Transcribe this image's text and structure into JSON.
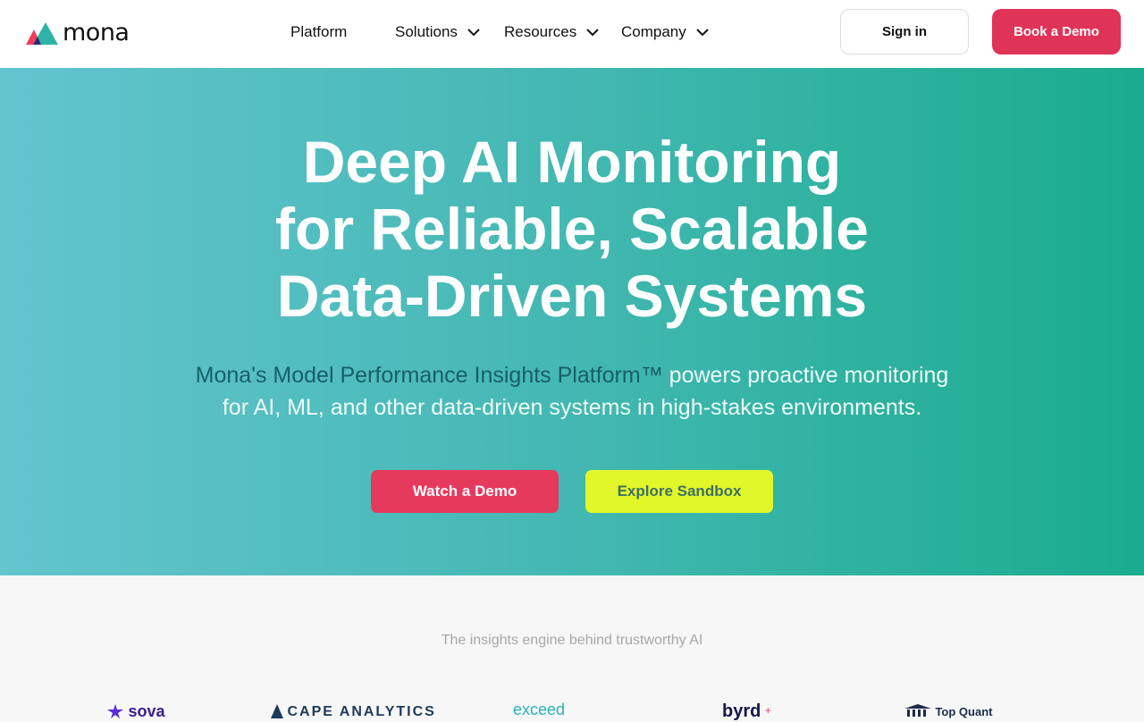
{
  "header": {
    "logo_text": "mona",
    "nav": [
      {
        "label": "Platform",
        "has_dropdown": false
      },
      {
        "label": "Solutions",
        "has_dropdown": true
      },
      {
        "label": "Resources",
        "has_dropdown": true
      },
      {
        "label": "Company",
        "has_dropdown": true
      }
    ],
    "sign_in_label": "Sign in",
    "book_demo_label": "Book a Demo"
  },
  "hero": {
    "title_lines": [
      "Deep AI Monitoring",
      "for Reliable, Scalable",
      "Data-Driven Systems"
    ],
    "subtitle_strong": "Mona's Model Performance Insights Platform™",
    "subtitle_rest_1": " powers proactive monitoring",
    "subtitle_rest_2": "for AI, ML, and other data-driven systems in high-stakes environments.",
    "watch_demo_label": "Watch a Demo",
    "explore_sandbox_label": "Explore Sandbox"
  },
  "trust": {
    "tagline": "The insights engine behind trustworthy AI",
    "logos": [
      "sova",
      "CAPE ANALYTICS",
      "exceed",
      "byrd",
      "Top Quant"
    ]
  },
  "colors": {
    "brand_red": "#df3457",
    "lime": "#e2f72a",
    "hero_gradient_start": "#63c5cf",
    "hero_gradient_end": "#1aac8e"
  }
}
